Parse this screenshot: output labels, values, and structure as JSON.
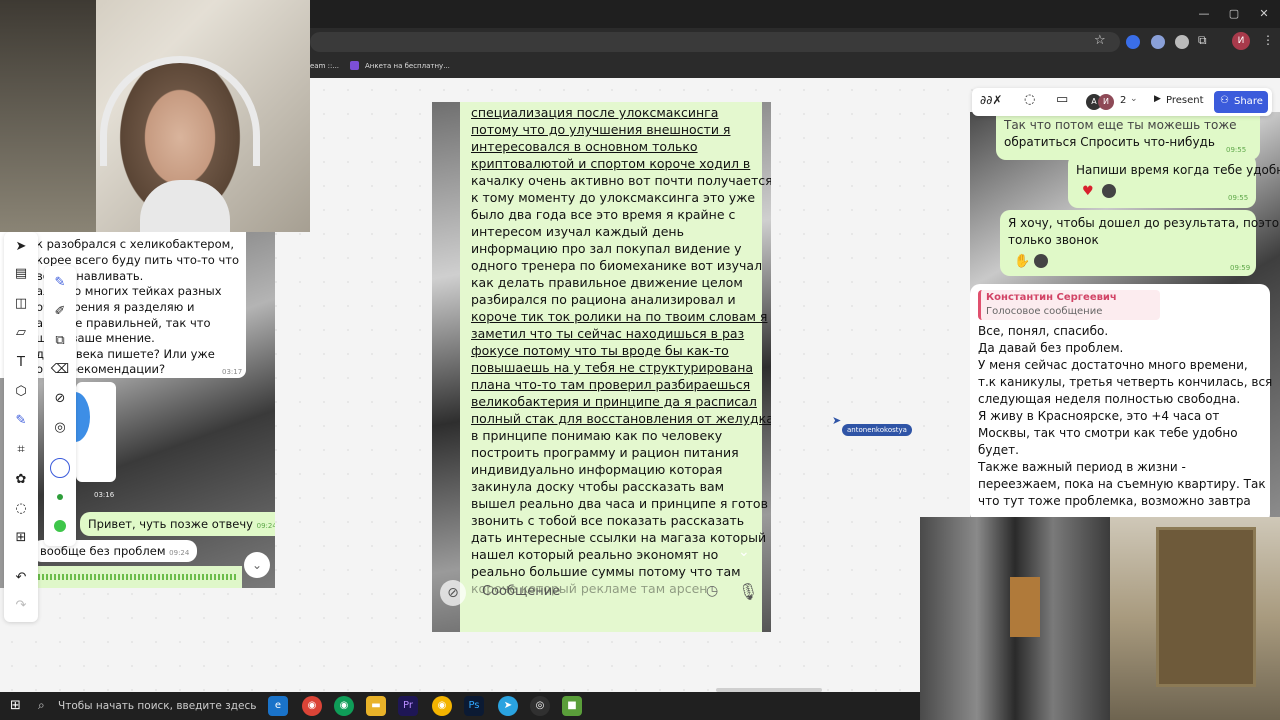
{
  "browser": {
    "window_controls": [
      "—",
      "▢",
      "✕"
    ],
    "bookmarks": [
      {
        "label": "eam ::..."
      },
      {
        "label": "Анкета на бесплатну..."
      }
    ],
    "profile_initial": "И"
  },
  "miro": {
    "top_bar": {
      "collaborators_count": "2",
      "avatar_initials": [
        "А",
        "И"
      ],
      "present_label": "Present",
      "share_label": "Share"
    },
    "cursor_label": "antonenkokostya"
  },
  "left_chat": {
    "lines": [
      "к разобрался с хеликобактером,",
      "корее всего буду пить что-то что",
      "восстанавливать.",
      "ался во многих тейках разных",
      "очку зрения я разделяю и",
      "а более правильней, так что",
      "шать ваше мнение.",
      "д человека пишете? Или уже",
      "овые рекомендации?"
    ],
    "lines_time": "03:17",
    "voice_time": "03:16",
    "reply_text": "Привет, чуть позже отвечу",
    "reply_time": "09:24",
    "white_text": "вообще без проблем",
    "white_time": "09:24"
  },
  "center_message": {
    "lines": [
      "специализация после улоксмаксинга",
      "потому что до улучшения внешности я",
      "интересовался в основном только",
      "криптовалютой и спортом короче ходил в",
      "качалку очень активно вот почти получается",
      "к тому моменту до улоксмаксинга это уже",
      "было два года все это время я крайне с",
      "интересом изучал каждый день",
      "информацию про зал покупал видение у",
      "одного тренера по биомеханике вот изучал",
      "как делать правильное движение целом",
      "разбирался по рациона анализировал и",
      "короче тик ток ролики на по твоим словам я",
      "заметил что ты сейчас находишься в раз",
      "фокусе потому что ты вроде бы как-то",
      "повышаешь на у тебя не структурирована",
      "плана что-то там проверил разбираешься",
      "великобактерия и принципе да я расписал",
      "полный стак для восстановления от желудка",
      "в принципе понимаю как по человеку",
      "построить программу и рацион питания",
      "индивидуально информацию которая",
      "закинула доску чтобы рассказать вам",
      "вышел реально два часа и принципе я готов",
      "звонить с тобой все показать рассказать",
      "дать интересные ссылки на магаза который",
      "нашел который реально экономят но",
      "реально большие суммы потому что там",
      "короче который рекламе там арсен"
    ],
    "compose_placeholder": "Сообщение"
  },
  "right_chat": {
    "top_partial": "Так что потом еще ты можешь тоже",
    "msg1": "обратиться Спросить что-нибудь",
    "msg1_time": "09:55",
    "msg2": "Напиши время когда тебе удобно",
    "msg2_time": "09:55",
    "msg3_lines": [
      "Я хочу, чтобы дошел до результата, поэтому",
      "только звонок"
    ],
    "msg3_time": "09:59",
    "reply_sender": "Константин Сергеевич",
    "reply_type": "Голосовое сообщение",
    "body_lines": [
      "Все, понял, спасибо.",
      "Да давай без проблем.",
      "У меня сейчас достаточно много времени,",
      "т.к каникулы, третья четверть кончилась, вся",
      "следующая неделя полностью свободна.",
      "Я живу в Красноярске, это +4 часа от",
      "Москвы, так что смотри как тебе удобно",
      "будет.",
      "Также важный период в жизни -",
      "переезжаем, пока на съемную квартиру. Так",
      "что тут тоже проблемка, возможно завтра"
    ]
  },
  "taskbar": {
    "search_placeholder": "Чтобы начать поиск, введите здесь",
    "apps": [
      "edge",
      "chrome",
      "chrome",
      "files",
      "Pr",
      "chrome",
      "Ps",
      "telegram",
      "obs",
      "minecraft"
    ]
  },
  "colors": {
    "accent": "#3b5bdb",
    "bubble_green": "#e0f9c8",
    "cursor_tag": "#2f54a6"
  }
}
